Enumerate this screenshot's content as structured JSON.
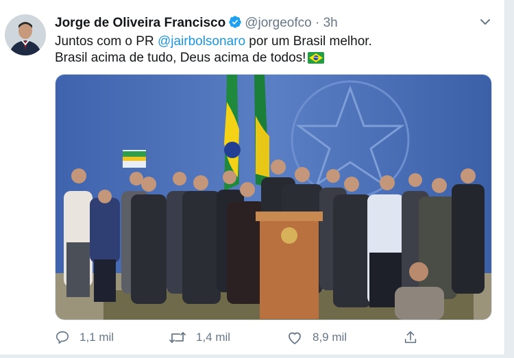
{
  "tweet": {
    "author": {
      "name": "Jorge de Oliveira Francisco",
      "handle": "@jorgeofco",
      "separator": "·",
      "time": "3h"
    },
    "text": {
      "line1_prefix": "Juntos com o PR ",
      "line1_mention": "@jairbolsonaro",
      "line1_suffix": " por um Brasil melhor.",
      "line2": "Brasil acima de tudo, Deus acima de todos!"
    },
    "actions": {
      "replies": "1,1 mil",
      "retweets": "1,4 mil",
      "likes": "8,9 mil"
    },
    "colors": {
      "accent": "#1da1f2",
      "secondary_text": "#657786",
      "primary_text": "#14171a"
    },
    "icons": [
      "verified-badge-icon",
      "chevron-down-icon",
      "brazil-flag-icon",
      "reply-icon",
      "retweet-icon",
      "like-icon",
      "share-icon"
    ]
  }
}
